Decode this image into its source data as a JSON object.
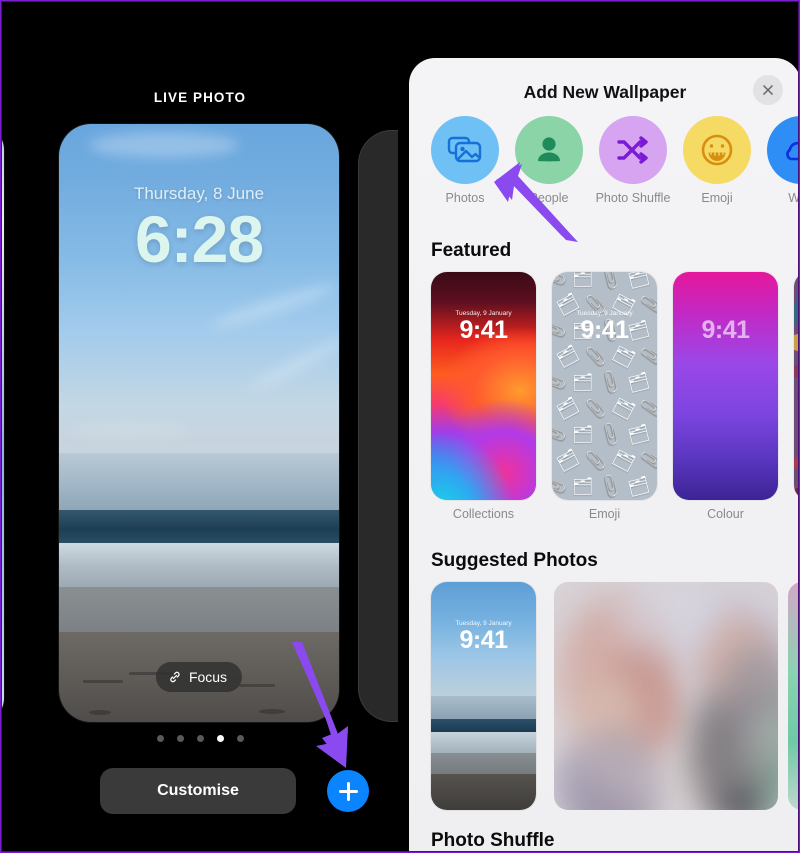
{
  "annotation": {
    "arrow_color": "#8a4af0",
    "arrow_count": 2
  },
  "left_panel": {
    "name": "lock-screen-gallery",
    "header_label": "LIVE PHOTO",
    "preview": {
      "date": "Thursday, 8 June",
      "time": "6:28",
      "focus_pill_label": "Focus",
      "focus_icon": "link-icon"
    },
    "page_dots": {
      "count": 5,
      "active_index": 3
    },
    "customise_button_label": "Customise",
    "add_button": {
      "icon": "plus-icon",
      "color": "#0a84ff"
    }
  },
  "right_panel": {
    "sheet": {
      "title": "Add New Wallpaper",
      "close_icon": "close-icon",
      "categories": [
        {
          "label": "Photos",
          "icon": "photos-icon",
          "bg": "#6fc0f5",
          "fg": "#1570d8"
        },
        {
          "label": "People",
          "icon": "person-icon",
          "bg": "#8bd4a8",
          "fg": "#1f8a5a"
        },
        {
          "label": "Photo Shuffle",
          "icon": "shuffle-icon",
          "bg": "#d6a4f0",
          "fg": "#7a1ad4"
        },
        {
          "label": "Emoji",
          "icon": "smiley-icon",
          "bg": "#f5da63",
          "fg": "#d88f10"
        },
        {
          "label": "Wea",
          "icon": "weather-cloud-icon",
          "bg": "#2f8ef5",
          "fg": "#0b2ee0"
        }
      ],
      "sections": [
        {
          "title": "Featured",
          "items": [
            {
              "label": "Collections",
              "date": "Tuesday, 9 January",
              "time": "9:41",
              "art": "collections"
            },
            {
              "label": "Emoji",
              "date": "Tuesday, 9 January",
              "time": "9:41",
              "art": "emoji"
            },
            {
              "label": "Colour",
              "date": "",
              "time": "9:41",
              "art": "colour"
            },
            {
              "label": "",
              "date": "",
              "time": "",
              "art": "peek"
            }
          ]
        },
        {
          "title": "Suggested Photos",
          "items": [
            {
              "label": "",
              "date": "Tuesday, 9 January",
              "time": "9:41",
              "art": "beach"
            }
          ]
        },
        {
          "title": "Photo Shuffle",
          "items": []
        }
      ]
    }
  }
}
